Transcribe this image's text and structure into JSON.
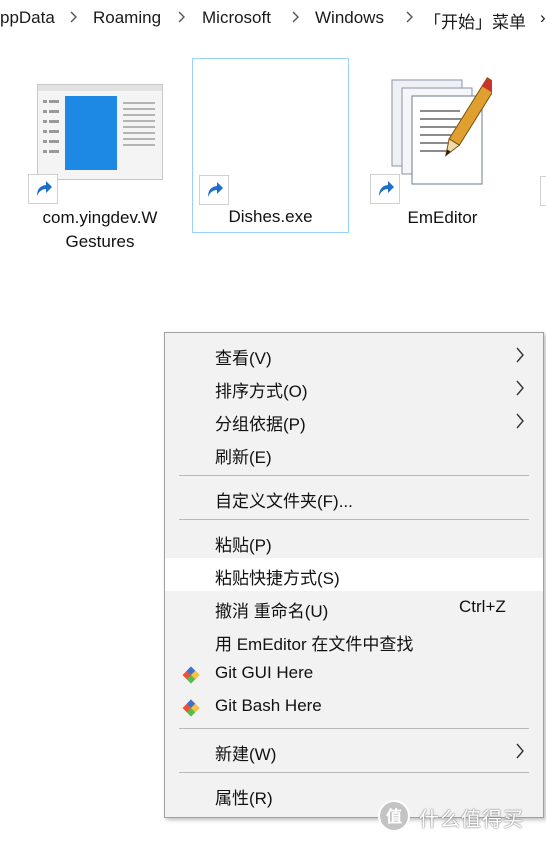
{
  "breadcrumb": {
    "items": [
      "ppData",
      "Roaming",
      "Microsoft",
      "Windows",
      "「开始」菜单"
    ],
    "trailing": "›"
  },
  "files": [
    {
      "name_line1": "com.yingdev.W",
      "name_line2": "Gestures",
      "icon": "app-window-thumbnail-icon"
    },
    {
      "name_line1": "Dishes.exe",
      "name_line2": "",
      "icon": "blank-exe-icon",
      "selected": true
    },
    {
      "name_line1": "EmEditor",
      "name_line2": "",
      "icon": "emeditor-notepad-icon"
    }
  ],
  "context_menu": {
    "items": [
      {
        "label": "查看(V)",
        "submenu": true
      },
      {
        "label": "排序方式(O)",
        "submenu": true
      },
      {
        "label": "分组依据(P)",
        "submenu": true
      },
      {
        "label": "刷新(E)",
        "submenu": false
      },
      {
        "label": "自定义文件夹(F)...",
        "submenu": false
      },
      {
        "label": "粘贴(P)",
        "submenu": false
      },
      {
        "label": "粘贴快捷方式(S)",
        "submenu": false,
        "highlighted": true
      },
      {
        "label": "撤消 重命名(U)",
        "shortcut": "Ctrl+Z"
      },
      {
        "label": "用 EmEditor 在文件中查找"
      },
      {
        "label": "Git GUI Here",
        "icon": "git-icon"
      },
      {
        "label": "Git Bash Here",
        "icon": "git-icon"
      },
      {
        "label": "新建(W)",
        "submenu": true
      },
      {
        "label": "属性(R)"
      }
    ]
  },
  "watermark": {
    "text": "什么值得买",
    "logo": "值"
  },
  "colors": {
    "accent": "#0078d7",
    "selection_border": "#99d1ff",
    "menu_bg": "#f2f2f2",
    "menu_highlight": "#ffffff"
  }
}
